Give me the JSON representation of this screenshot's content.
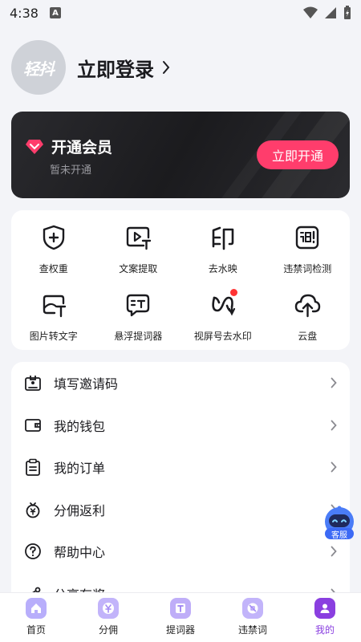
{
  "status": {
    "time": "4:38",
    "notif_letter": "A"
  },
  "profile": {
    "avatar_text": "轻抖",
    "login_label": "立即登录"
  },
  "vip": {
    "title": "开通会员",
    "subtitle": "暂未开通",
    "button_label": "立即开通",
    "accent": "#ff3d6c"
  },
  "tools": [
    {
      "label": "查权重",
      "icon": "shield-plus-icon"
    },
    {
      "label": "文案提取",
      "icon": "video-text-icon"
    },
    {
      "label": "去水映",
      "icon": "seal-icon"
    },
    {
      "label": "违禁词检测",
      "icon": "word-check-icon"
    },
    {
      "label": "图片转文字",
      "icon": "image-text-icon"
    },
    {
      "label": "悬浮提词器",
      "icon": "teleprompter-icon"
    },
    {
      "label": "视屏号去水印",
      "icon": "channels-icon"
    },
    {
      "label": "云盘",
      "icon": "cloud-upload-icon"
    }
  ],
  "menu": [
    {
      "label": "填写邀请码",
      "icon": "badge-icon"
    },
    {
      "label": "我的钱包",
      "icon": "wallet-icon"
    },
    {
      "label": "我的订单",
      "icon": "clipboard-icon"
    },
    {
      "label": "分佣返利",
      "icon": "money-bag-icon"
    },
    {
      "label": "帮助中心",
      "icon": "help-icon"
    },
    {
      "label": "分享有奖",
      "icon": "share-icon"
    }
  ],
  "service": {
    "label": "客服"
  },
  "nav": [
    {
      "label": "首页",
      "icon": "home-icon",
      "color": "#8b7cf6"
    },
    {
      "label": "分佣",
      "icon": "yen-icon",
      "color": "#a58cf5"
    },
    {
      "label": "提词器",
      "icon": "prompter-icon",
      "color": "#9c82f3"
    },
    {
      "label": "违禁词",
      "icon": "forbidden-word-icon",
      "color": "#a58cf5"
    },
    {
      "label": "我的",
      "icon": "profile-icon",
      "color": "#8a3fe0",
      "active": true
    }
  ]
}
